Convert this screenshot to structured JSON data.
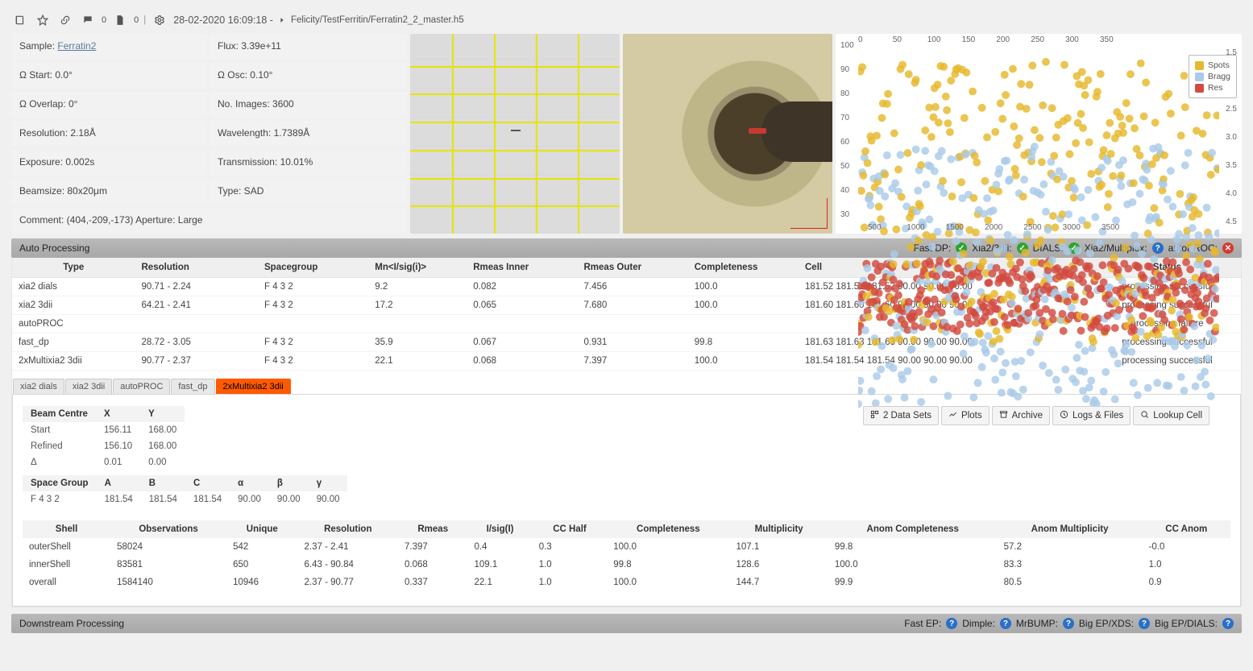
{
  "header": {
    "comment_count": "0",
    "doc_count": "0",
    "datetime": "28-02-2020 16:09:18 -",
    "breadcrumb": "Felicity/TestFerritin/Ferratin2_2_master.h5"
  },
  "meta": [
    {
      "label": "Sample:",
      "value": "Ferratin2",
      "link": true
    },
    {
      "label": "Flux:",
      "value": "3.39e+11"
    },
    {
      "label": "Ω Start:",
      "value": "0.0°"
    },
    {
      "label": "Ω Osc:",
      "value": "0.10°"
    },
    {
      "label": "Ω Overlap:",
      "value": "0°"
    },
    {
      "label": "No. Images:",
      "value": "3600"
    },
    {
      "label": "Resolution:",
      "value": "2.18Å"
    },
    {
      "label": "Wavelength:",
      "value": "1.7389Å"
    },
    {
      "label": "Exposure:",
      "value": "0.002s"
    },
    {
      "label": "Transmission:",
      "value": "10.01%"
    },
    {
      "label": "Beamsize:",
      "value": "80x20μm"
    },
    {
      "label": "Type:",
      "value": "SAD"
    }
  ],
  "meta_comment": "Comment: (404,-209,-173) Aperture: Large",
  "chart_data": {
    "type": "scatter",
    "xlabel": "",
    "ylabel_left": "",
    "ylabel_right": "",
    "x_ticks_top": [
      0,
      50,
      100,
      150,
      200,
      250,
      300,
      350
    ],
    "x_ticks_bottom": [
      500,
      1000,
      1500,
      2000,
      2500,
      3000,
      3500
    ],
    "y_ticks_left": [
      30,
      40,
      50,
      60,
      70,
      80,
      90,
      100
    ],
    "y_ticks_right": [
      1.5,
      2.0,
      2.5,
      3.0,
      3.5,
      4.0,
      4.5
    ],
    "legend": [
      "Spots",
      "Bragg",
      "Res"
    ],
    "colors": {
      "Spots": "#e6b82c",
      "Bragg": "#a9cbe8",
      "Res": "#d24b3f"
    },
    "note": "values approximated from pixels; ~350 x-points",
    "series_summary": {
      "Spots": {
        "approx_mean": 70,
        "approx_range": [
          38,
          98
        ]
      },
      "Bragg": {
        "approx_mean": 56,
        "approx_range": [
          30,
          88
        ]
      },
      "Res": {
        "approx_mean_right_axis": 3.7,
        "approx_range_right_axis": [
          3.3,
          4.5
        ]
      }
    }
  },
  "autoproc": {
    "title": "Auto Processing",
    "status_labels": {
      "fastdp": "Fast DP:",
      "xia23dii": "Xia2/3dii:",
      "dials": "DIALS:",
      "multiplex": "Xia2/Multiplex:",
      "autoproc": "autoPROC:"
    },
    "columns": [
      "Type",
      "Resolution",
      "Spacegroup",
      "Mn<I/sig(i)>",
      "Rmeas Inner",
      "Rmeas Outer",
      "Completeness",
      "Cell",
      "Status"
    ],
    "rows": [
      {
        "type": "xia2 dials",
        "res": "90.71 - 2.24",
        "sg": "F 4 3 2",
        "mn": "9.2",
        "ri": "0.082",
        "ro": "7.456",
        "comp": "100.0",
        "cell": "181.52 181.52 181.52 90.00 90.00 90.00",
        "status": "processing successful"
      },
      {
        "type": "xia2 3dii",
        "res": "64.21 - 2.41",
        "sg": "F 4 3 2",
        "mn": "17.2",
        "ri": "0.065",
        "ro": "7.680",
        "comp": "100.0",
        "cell": "181.60 181.60 181.60 90.00 90.00 90.00",
        "status": "processing successful"
      },
      {
        "type": "autoPROC",
        "res": "",
        "sg": "",
        "mn": "",
        "ri": "",
        "ro": "",
        "comp": "",
        "cell": "",
        "status": "processing failure"
      },
      {
        "type": "fast_dp",
        "res": "28.72 - 3.05",
        "sg": "F 4 3 2",
        "mn": "35.9",
        "ri": "0.067",
        "ro": "0.931",
        "comp": "99.8",
        "cell": "181.63 181.63 181.63 90.00 90.00 90.00",
        "status": "processing successful"
      },
      {
        "type": "2xMultixia2 3dii",
        "res": "90.77 - 2.37",
        "sg": "F 4 3 2",
        "mn": "22.1",
        "ri": "0.068",
        "ro": "7.397",
        "comp": "100.0",
        "cell": "181.54 181.54 181.54 90.00 90.00 90.00",
        "status": "processing successful"
      }
    ]
  },
  "tabs": [
    "xia2 dials",
    "xia2 3dii",
    "autoPROC",
    "fast_dp",
    "2xMultixia2 3dii"
  ],
  "active_tab": "2xMultixia2 3dii",
  "actions": [
    "2 Data Sets",
    "Plots",
    "Archive",
    "Logs & Files",
    "Lookup Cell"
  ],
  "beam": {
    "headers": [
      "Beam Centre",
      "X",
      "Y"
    ],
    "rows": [
      {
        "k": "Start",
        "x": "156.11",
        "y": "168.00"
      },
      {
        "k": "Refined",
        "x": "156.10",
        "y": "168.00"
      },
      {
        "k": "Δ",
        "x": "0.01",
        "y": "0.00"
      }
    ]
  },
  "spacegroup": {
    "headers": [
      "Space Group",
      "A",
      "B",
      "C",
      "α",
      "β",
      "γ"
    ],
    "row": {
      "sg": "F 4 3 2",
      "a": "181.54",
      "b": "181.54",
      "c": "181.54",
      "al": "90.00",
      "be": "90.00",
      "ga": "90.00"
    }
  },
  "shell": {
    "columns": [
      "Shell",
      "Observations",
      "Unique",
      "Resolution",
      "Rmeas",
      "I/sig(I)",
      "CC Half",
      "Completeness",
      "Multiplicity",
      "Anom Completeness",
      "Anom Multiplicity",
      "CC Anom"
    ],
    "rows": [
      {
        "s": "outerShell",
        "obs": "58024",
        "u": "542",
        "res": "2.37 - 2.41",
        "rm": "7.397",
        "is": "0.4",
        "cc": "0.3",
        "comp": "100.0",
        "mult": "107.1",
        "ac": "99.8",
        "am": "57.2",
        "cca": "-0.0"
      },
      {
        "s": "innerShell",
        "obs": "83581",
        "u": "650",
        "res": "6.43 - 90.84",
        "rm": "0.068",
        "is": "109.1",
        "cc": "1.0",
        "comp": "99.8",
        "mult": "128.6",
        "ac": "100.0",
        "am": "83.3",
        "cca": "1.0"
      },
      {
        "s": "overall",
        "obs": "1584140",
        "u": "10946",
        "res": "2.37 - 90.77",
        "rm": "0.337",
        "is": "22.1",
        "cc": "1.0",
        "comp": "100.0",
        "mult": "144.7",
        "ac": "99.9",
        "am": "80.5",
        "cca": "0.9"
      }
    ]
  },
  "downstream": {
    "title": "Downstream Processing",
    "labels": {
      "fastep": "Fast EP:",
      "dimple": "Dimple:",
      "mrbump": "MrBUMP:",
      "bigepxds": "Big EP/XDS:",
      "bigepdials": "Big EP/DIALS:"
    }
  }
}
